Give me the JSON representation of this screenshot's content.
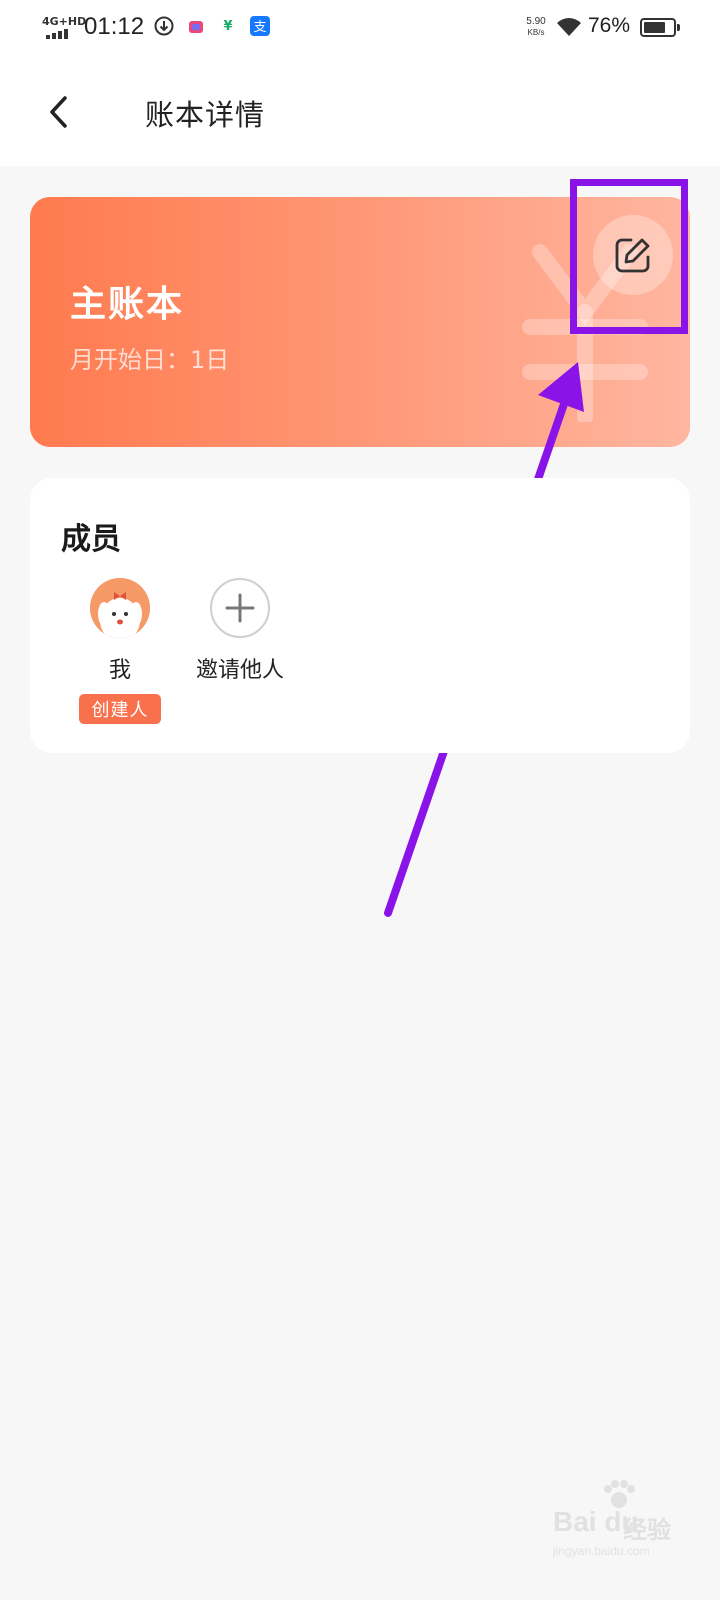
{
  "status_bar": {
    "network": "4G+HD",
    "time": "01:12",
    "speed_value": "5.90",
    "speed_unit": "KB/s",
    "battery_percent": "76%",
    "battery_level": 0.76
  },
  "header": {
    "title": "账本详情"
  },
  "account": {
    "name": "主账本",
    "month_start": "月开始日：1日",
    "accent_color": "#ff7a4e"
  },
  "members": {
    "title": "成员",
    "self_name": "我",
    "creator_badge": "创建人",
    "invite_label": "邀请他人"
  },
  "annotation": {
    "highlight_color": "#8a14e8"
  },
  "watermark": {
    "logo_text": "Bai du",
    "suffix": "经验",
    "url": "jingyan.baidu.com"
  }
}
